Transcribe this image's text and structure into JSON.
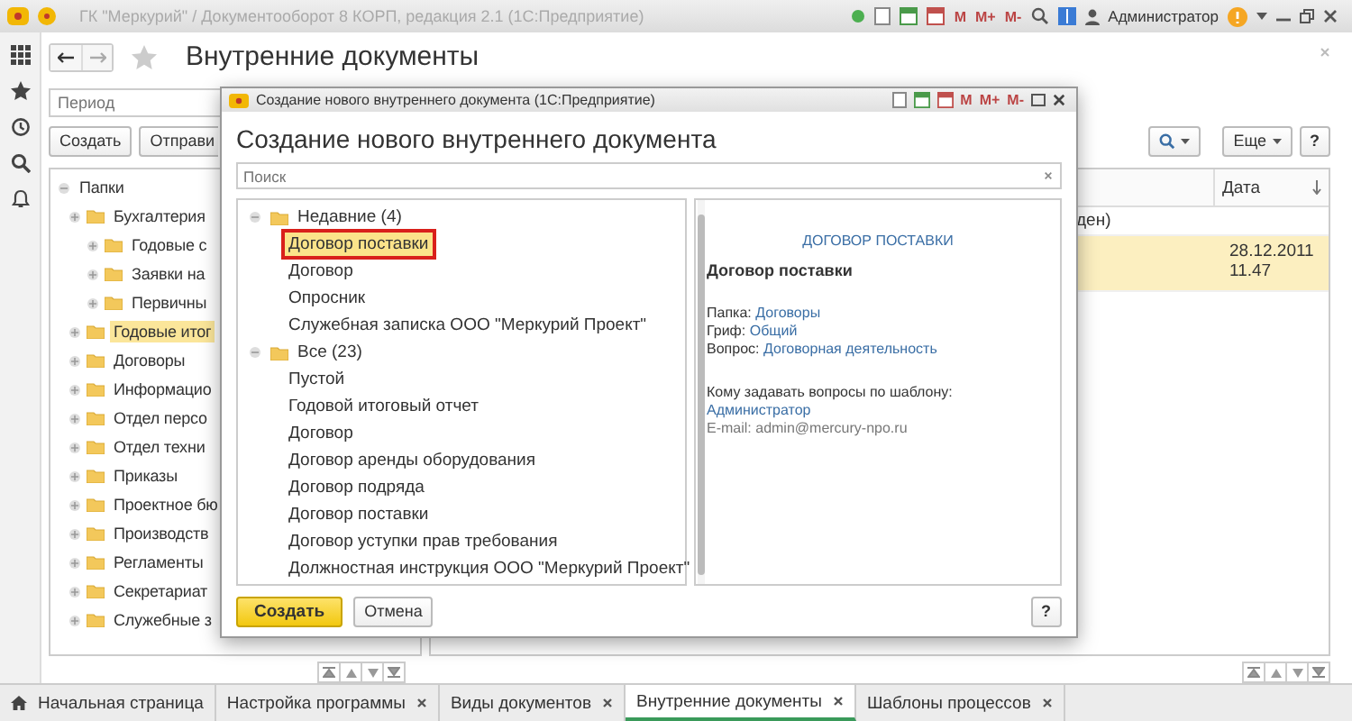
{
  "app": {
    "title": "ГК \"Меркурий\" / Документооборот 8 КОРП, редакция 2.1 (1С:Предприятие)",
    "memory_buttons": [
      "M",
      "M+",
      "M-"
    ],
    "user": "Администратор"
  },
  "page": {
    "title": "Внутренние документы",
    "period_placeholder": "Период",
    "actions": [
      "Создать",
      "Отправи"
    ],
    "more": "Еще",
    "help": "?"
  },
  "folders": {
    "label": "Папки",
    "children": [
      {
        "label": "Бухгалтерия",
        "selected": false,
        "children": [
          {
            "label": "Годовые с",
            "selected": false
          },
          {
            "label": "Заявки на",
            "selected": false
          },
          {
            "label": "Первичны",
            "selected": false
          }
        ]
      },
      {
        "label": "Годовые итог",
        "selected": true
      },
      {
        "label": "Договоры",
        "selected": false
      },
      {
        "label": "Информацио",
        "selected": false
      },
      {
        "label": "Отдел персо",
        "selected": false
      },
      {
        "label": "Отдел техни",
        "selected": false
      },
      {
        "label": "Приказы",
        "selected": false
      },
      {
        "label": "Проектное бю",
        "selected": false
      },
      {
        "label": "Производств",
        "selected": false
      },
      {
        "label": "Регламенты",
        "selected": false
      },
      {
        "label": "Секретариат",
        "selected": false
      },
      {
        "label": "Служебные з",
        "selected": false
      }
    ]
  },
  "table": {
    "columns": [
      {
        "label": "Дата"
      }
    ],
    "rows": [
      {
        "column_1": "ден)",
        "selected": false
      },
      {
        "date": "28.12.2011 11.47",
        "selected": true
      }
    ]
  },
  "dialog": {
    "window_title": "Создание нового внутреннего документа (1С:Предприятие)",
    "memory_buttons": [
      "M",
      "M+",
      "M-"
    ],
    "heading": "Создание нового внутреннего документа",
    "search_placeholder": "Поиск",
    "groups": [
      {
        "label": "Недавние (4)",
        "expanded": true,
        "items": [
          {
            "label": "Договор поставки",
            "selected": true
          },
          {
            "label": "Договор",
            "selected": false
          },
          {
            "label": "Опросник",
            "selected": false
          },
          {
            "label": "Служебная записка ООО \"Меркурий Проект\"",
            "selected": false
          }
        ]
      },
      {
        "label": "Все (23)",
        "expanded": true,
        "items": [
          {
            "label": "Пустой",
            "selected": false
          },
          {
            "label": "Годовой итоговый отчет",
            "selected": false
          },
          {
            "label": "Договор",
            "selected": false
          },
          {
            "label": "Договор аренды оборудования",
            "selected": false
          },
          {
            "label": "Договор подряда",
            "selected": false
          },
          {
            "label": "Договор поставки",
            "selected": false
          },
          {
            "label": "Договор уступки прав требования",
            "selected": false
          },
          {
            "label": "Должностная инструкция ООО \"Меркурий Проект\"",
            "selected": false
          }
        ]
      }
    ],
    "preview": {
      "link": "ДОГОВОР ПОСТАВКИ",
      "title": "Договор поставки",
      "fields": [
        {
          "label": "Папка:",
          "value": "Договоры"
        },
        {
          "label": "Гриф:",
          "value": "Общий"
        },
        {
          "label": "Вопрос:",
          "value": "Договорная деятельность"
        }
      ],
      "contact": {
        "label": "Кому задавать вопросы по шаблону:",
        "value": "Администратор"
      },
      "email": "E-mail: admin@mercury-npo.ru"
    },
    "create": "Создать",
    "cancel": "Отмена",
    "help": "?"
  },
  "tabs": [
    {
      "label": "Начальная страница",
      "kind": "home",
      "selected": false
    },
    {
      "label": "Настройка программы",
      "kind": "page",
      "selected": false
    },
    {
      "label": "Виды документов",
      "kind": "page",
      "selected": false
    },
    {
      "label": "Внутренние документы",
      "kind": "page",
      "selected": true
    },
    {
      "label": "Шаблоны процессов",
      "kind": "page",
      "selected": false
    }
  ]
}
